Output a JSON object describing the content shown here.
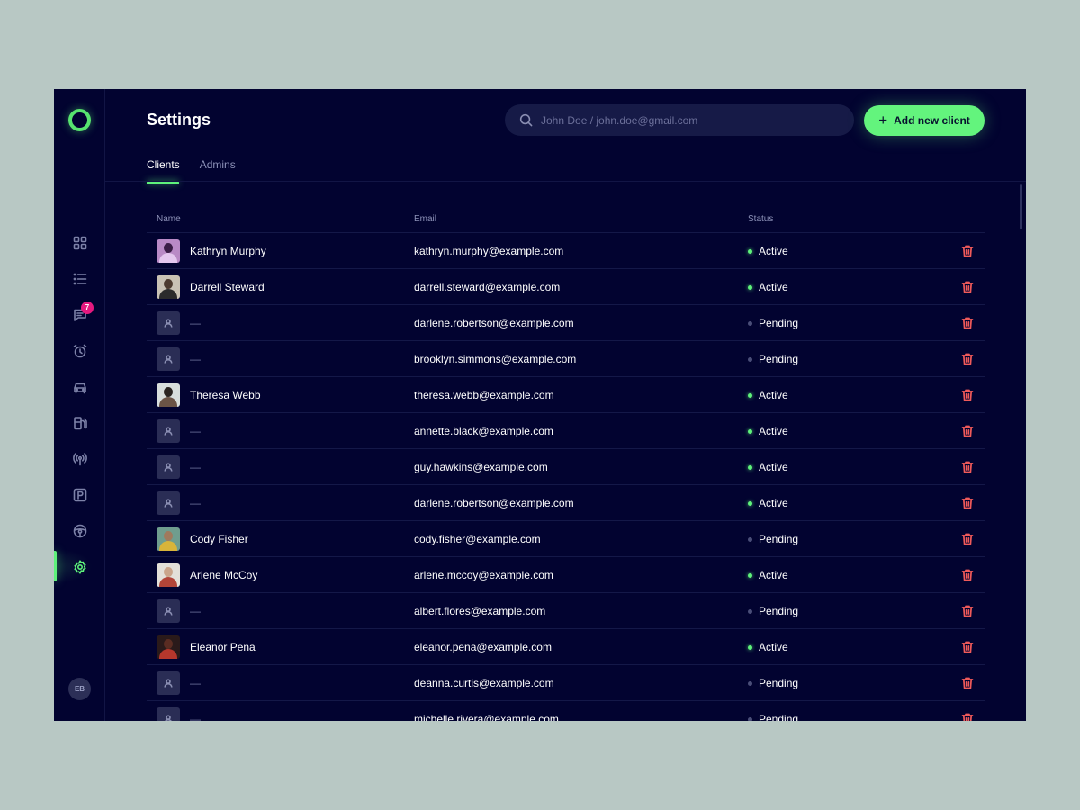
{
  "header": {
    "title": "Settings",
    "search_placeholder": "John Doe / john.doe@gmail.com",
    "add_button_label": "Add new client"
  },
  "tabs": [
    {
      "label": "Clients",
      "active": true
    },
    {
      "label": "Admins",
      "active": false
    }
  ],
  "sidebar": {
    "items": [
      {
        "icon": "dashboard-icon",
        "active": false
      },
      {
        "icon": "list-icon",
        "active": false
      },
      {
        "icon": "chat-icon",
        "active": false,
        "badge": "7"
      },
      {
        "icon": "alarm-clock-icon",
        "active": false
      },
      {
        "icon": "car-icon",
        "active": false
      },
      {
        "icon": "fuel-station-icon",
        "active": false
      },
      {
        "icon": "broadcast-icon",
        "active": false
      },
      {
        "icon": "parking-icon",
        "active": false
      },
      {
        "icon": "steering-wheel-icon",
        "active": false
      },
      {
        "icon": "gear-icon",
        "active": true
      }
    ],
    "user_initials": "EB"
  },
  "table": {
    "columns": {
      "name": "Name",
      "email": "Email",
      "status": "Status"
    },
    "rows": [
      {
        "name": "Kathryn Murphy",
        "email": "kathryn.murphy@example.com",
        "status": "Active",
        "avatar": "photo",
        "colors": [
          "#b98ac6",
          "#3a1d46",
          "#e4c7ef"
        ]
      },
      {
        "name": "Darrell Steward",
        "email": "darrell.steward@example.com",
        "status": "Active",
        "avatar": "photo",
        "colors": [
          "#c9c2b4",
          "#4d3b2f",
          "#2b2b2b"
        ]
      },
      {
        "name": "—",
        "email": "darlene.robertson@example.com",
        "status": "Pending",
        "avatar": "placeholder"
      },
      {
        "name": "—",
        "email": "brooklyn.simmons@example.com",
        "status": "Pending",
        "avatar": "placeholder"
      },
      {
        "name": "Theresa Webb",
        "email": "theresa.webb@example.com",
        "status": "Active",
        "avatar": "photo",
        "colors": [
          "#d8dedc",
          "#2a2420",
          "#6b5446"
        ]
      },
      {
        "name": "—",
        "email": "annette.black@example.com",
        "status": "Active",
        "avatar": "placeholder"
      },
      {
        "name": "—",
        "email": "guy.hawkins@example.com",
        "status": "Active",
        "avatar": "placeholder"
      },
      {
        "name": "—",
        "email": "darlene.robertson@example.com",
        "status": "Active",
        "avatar": "placeholder"
      },
      {
        "name": "Cody Fisher",
        "email": "cody.fisher@example.com",
        "status": "Pending",
        "avatar": "photo",
        "colors": [
          "#6f9d8e",
          "#a07a5d",
          "#d8b43a"
        ]
      },
      {
        "name": "Arlene McCoy",
        "email": "arlene.mccoy@example.com",
        "status": "Active",
        "avatar": "photo",
        "colors": [
          "#e3e0d8",
          "#caa58a",
          "#b24538"
        ]
      },
      {
        "name": "—",
        "email": "albert.flores@example.com",
        "status": "Pending",
        "avatar": "placeholder"
      },
      {
        "name": "Eleanor Pena",
        "email": "eleanor.pena@example.com",
        "status": "Active",
        "avatar": "photo",
        "colors": [
          "#2a1a1a",
          "#5a2c22",
          "#b5372c"
        ]
      },
      {
        "name": "—",
        "email": "deanna.curtis@example.com",
        "status": "Pending",
        "avatar": "placeholder"
      },
      {
        "name": "—",
        "email": "michelle.rivera@example.com",
        "status": "Pending",
        "avatar": "placeholder"
      }
    ]
  },
  "colors": {
    "accent": "#5ef27b",
    "background": "#020330",
    "delete": "#f05a5a",
    "badge": "#e5197f"
  }
}
